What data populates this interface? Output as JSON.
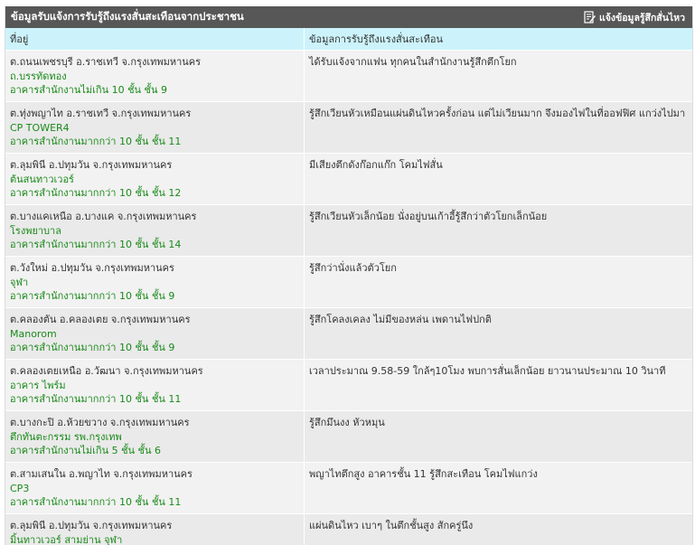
{
  "panel": {
    "title": "ข้อมูลรับแจ้งการรับรู้ถึงแรงสั่นสะเทือนจากประชาชน",
    "report_link_label": "แจ้งข้อมูลรู้สึกสั่นไหว",
    "report_icon": "edit-note-icon"
  },
  "columns": {
    "location": "ที่อยู่",
    "description": "ข้อมูลการรับรู้ถึงแรงสั่นสะเทือน"
  },
  "rows": [
    {
      "location": "ต.ถนนเพชรบุรี อ.ราชเทวี จ.กรุงเทพมหานคร",
      "place": "ถ.บรรทัดทอง",
      "building": "อาคารสำนักงานไม่เกิน 10 ชั้น ชั้น 9",
      "description": "ได้รับแจ้งจากแฟน ทุกคนในสำนักงานรู้สึกตึกโยก"
    },
    {
      "location": "ต.ทุ่งพญาไท อ.ราชเทวี จ.กรุงเทพมหานคร",
      "place": "CP TOWER4",
      "building": "อาคารสำนักงานมากกว่า 10 ชั้น ชั้น 11",
      "description": "รู้สึกเวียนหัวเหมือนแผ่นดินไหวครั้งก่อน แต่ไม่เวียนมาก จึงมองไฟในที่ออฟฟิศ แกว่งไปมา"
    },
    {
      "location": "ต.ลุมพินี อ.ปทุมวัน จ.กรุงเทพมหานคร",
      "place": "ต้นสนทาวเวอร์",
      "building": "อาคารสำนักงานมากกว่า 10 ชั้น ชั้น 12",
      "description": "มีเสียงตึกดังก๊อกแก๊ก โคมไฟสั่น"
    },
    {
      "location": "ต.บางแคเหนือ อ.บางแค จ.กรุงเทพมหานคร",
      "place": "โรงพยาบาล",
      "building": "อาคารสำนักงานมากกว่า 10 ชั้น ชั้น 14",
      "description": "รู้สึกเวียนหัวเล็กน้อย นั่งอยู่บนเก้าอี้รู้สึกว่าตัวโยกเล็กน้อย"
    },
    {
      "location": "ต.วังใหม่ อ.ปทุมวัน จ.กรุงเทพมหานคร",
      "place": "จุฬา",
      "building": "อาคารสำนักงานมากกว่า 10 ชั้น ชั้น 9",
      "description": "รู้สึกว่านั่งแล้วตัวโยก"
    },
    {
      "location": "ต.คลองตัน อ.คลองเตย จ.กรุงเทพมหานคร",
      "place": "Manorom",
      "building": "อาคารสำนักงานมากกว่า 10 ชั้น ชั้น 9",
      "description": "รู้สึกโคลงเคลง ไม่มีของหล่น เพดานไฟปกติ"
    },
    {
      "location": "ต.คลองเตยเหนือ อ.วัฒนา จ.กรุงเทพมหานคร",
      "place": "อาคาร ไพร์ม",
      "building": "อาคารสำนักงานมากกว่า 10 ชั้น ชั้น 11",
      "description": "เวลาประมาณ 9.58-59 ใกล้ๆ10โมง พบการสั่นเล็กน้อย ยาวนานประมาณ 10 วินาที"
    },
    {
      "location": "ต.บางกะปิ อ.ห้วยขวาง จ.กรุงเทพมหานคร",
      "place": "ตึกทันตะกรรม รพ.กรุงเทพ",
      "building": "อาคารสำนักงานไม่เกิน 5 ชั้น ชั้น 6",
      "description": "รู้สึกมึนงง หัวหมุน"
    },
    {
      "location": "ต.สามเสนใน อ.พญาไท จ.กรุงเทพมหานคร",
      "place": "CP3",
      "building": "อาคารสำนักงานมากกว่า 10 ชั้น ชั้น 11",
      "description": "พญาไทตึกสูง อาคารชั้น 11 รู้สึกสะเทือน โคมไฟแกว่ง"
    },
    {
      "location": "ต.ลุมพินี อ.ปทุมวัน จ.กรุงเทพมหานคร",
      "place": "มิ้นทาวเวอร์ สามย่าน จุฬา",
      "building": "",
      "description": "แผ่นดินไหว เบาๆ ในตึกชั้นสูง สักครู่นึง"
    }
  ]
}
